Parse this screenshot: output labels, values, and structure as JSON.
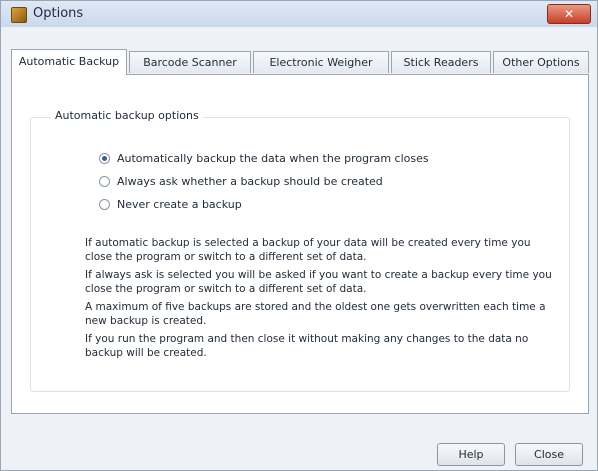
{
  "window": {
    "title": "Options",
    "close_glyph": "✕"
  },
  "tabs": [
    {
      "label": "Automatic Backup",
      "active": true
    },
    {
      "label": "Barcode Scanner",
      "active": false
    },
    {
      "label": "Electronic Weigher",
      "active": false
    },
    {
      "label": "Stick Readers",
      "active": false
    },
    {
      "label": "Other Options",
      "active": false
    }
  ],
  "group": {
    "label": "Automatic backup options",
    "options": [
      {
        "label": "Automatically backup the data when the program closes",
        "checked": true
      },
      {
        "label": "Always ask whether a backup should be created",
        "checked": false
      },
      {
        "label": "Never create a backup",
        "checked": false
      }
    ],
    "paragraphs": [
      "If automatic backup is selected a backup of your data will be created every time you close the program or switch to a different set of data.",
      "If always ask is selected you will be asked if you want to create a backup every time you close the program or switch to a different set of data.",
      "A maximum of five backups are stored and the oldest one gets overwritten each time a new backup is created.",
      "If you run the program and then close it without making any changes to the data no backup will be created."
    ]
  },
  "buttons": {
    "help": "Help",
    "close": "Close"
  }
}
